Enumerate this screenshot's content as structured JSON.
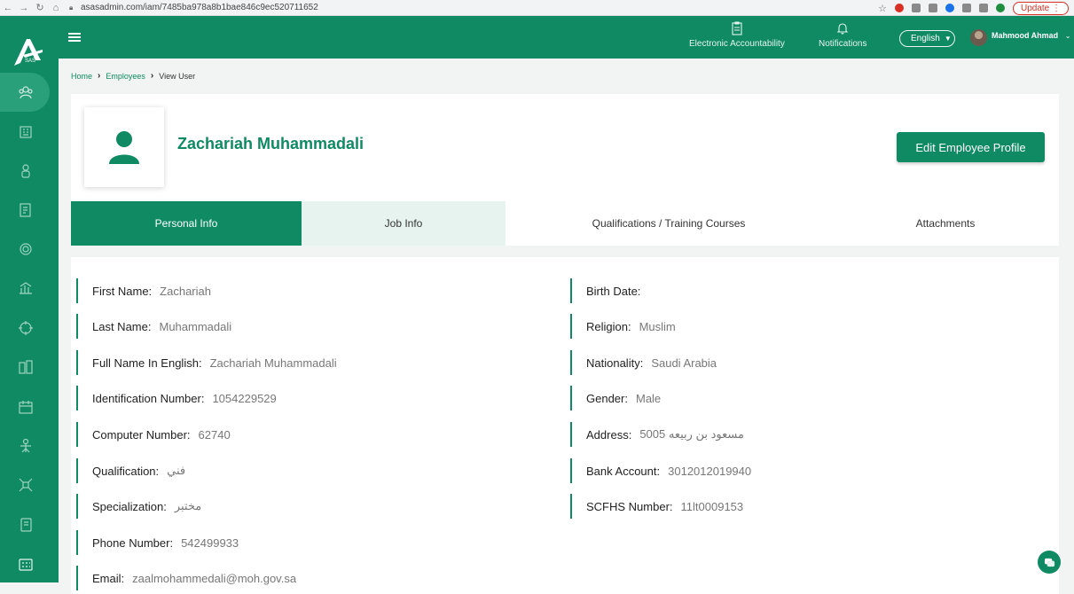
{
  "browser": {
    "url": "asasadmin.com/iam/7485ba978a8b1bae846c9ec520711652",
    "update_label": "Update"
  },
  "sidebar": {
    "logo_text": "SAS",
    "items": [
      "employees-icon",
      "branches-icon",
      "person-icon",
      "documents-icon",
      "circles-icon",
      "finance-icon",
      "target-icon",
      "building-icon",
      "calendar-icon",
      "team-icon",
      "network-icon",
      "book-icon",
      "grid-icon"
    ]
  },
  "header": {
    "electronic_accountability": "Electronic Accountability",
    "notifications": "Notifications",
    "language": "English",
    "user_name": "Mahmood Ahmad"
  },
  "breadcrumb": {
    "home": "Home",
    "employees": "Employees",
    "current": "View User"
  },
  "profile": {
    "name": "Zachariah Muhammadali",
    "edit_button": "Edit Employee Profile"
  },
  "tabs": [
    "Personal Info",
    "Job Info",
    "Qualifications / Training Courses",
    "Attachments"
  ],
  "fields_left": [
    {
      "label": "First Name:",
      "value": "Zachariah"
    },
    {
      "label": "Last Name:",
      "value": "Muhammadali"
    },
    {
      "label": "Full Name In English:",
      "value": "Zachariah Muhammadali"
    },
    {
      "label": "Identification Number:",
      "value": "1054229529"
    },
    {
      "label": "Computer Number:",
      "value": "62740"
    },
    {
      "label": "Qualification:",
      "value": "فني"
    },
    {
      "label": "Specialization:",
      "value": "مختبر"
    },
    {
      "label": "Phone Number:",
      "value": "542499933"
    },
    {
      "label": "Email:",
      "value": "zaalmohammedali@moh.gov.sa"
    }
  ],
  "fields_right": [
    {
      "label": "Birth Date:",
      "value": ""
    },
    {
      "label": "Religion:",
      "value": "Muslim"
    },
    {
      "label": "Nationality:",
      "value": "Saudi Arabia"
    },
    {
      "label": "Gender:",
      "value": "Male"
    },
    {
      "label": "Address:",
      "value": "مسعود بن ربيعه 5005"
    },
    {
      "label": "Bank Account:",
      "value": "3012012019940"
    },
    {
      "label": "SCFHS Number:",
      "value": "11lt0009153"
    }
  ],
  "colors": {
    "primary": "#0f8a62",
    "tab_hover": "#e7f3ef"
  }
}
